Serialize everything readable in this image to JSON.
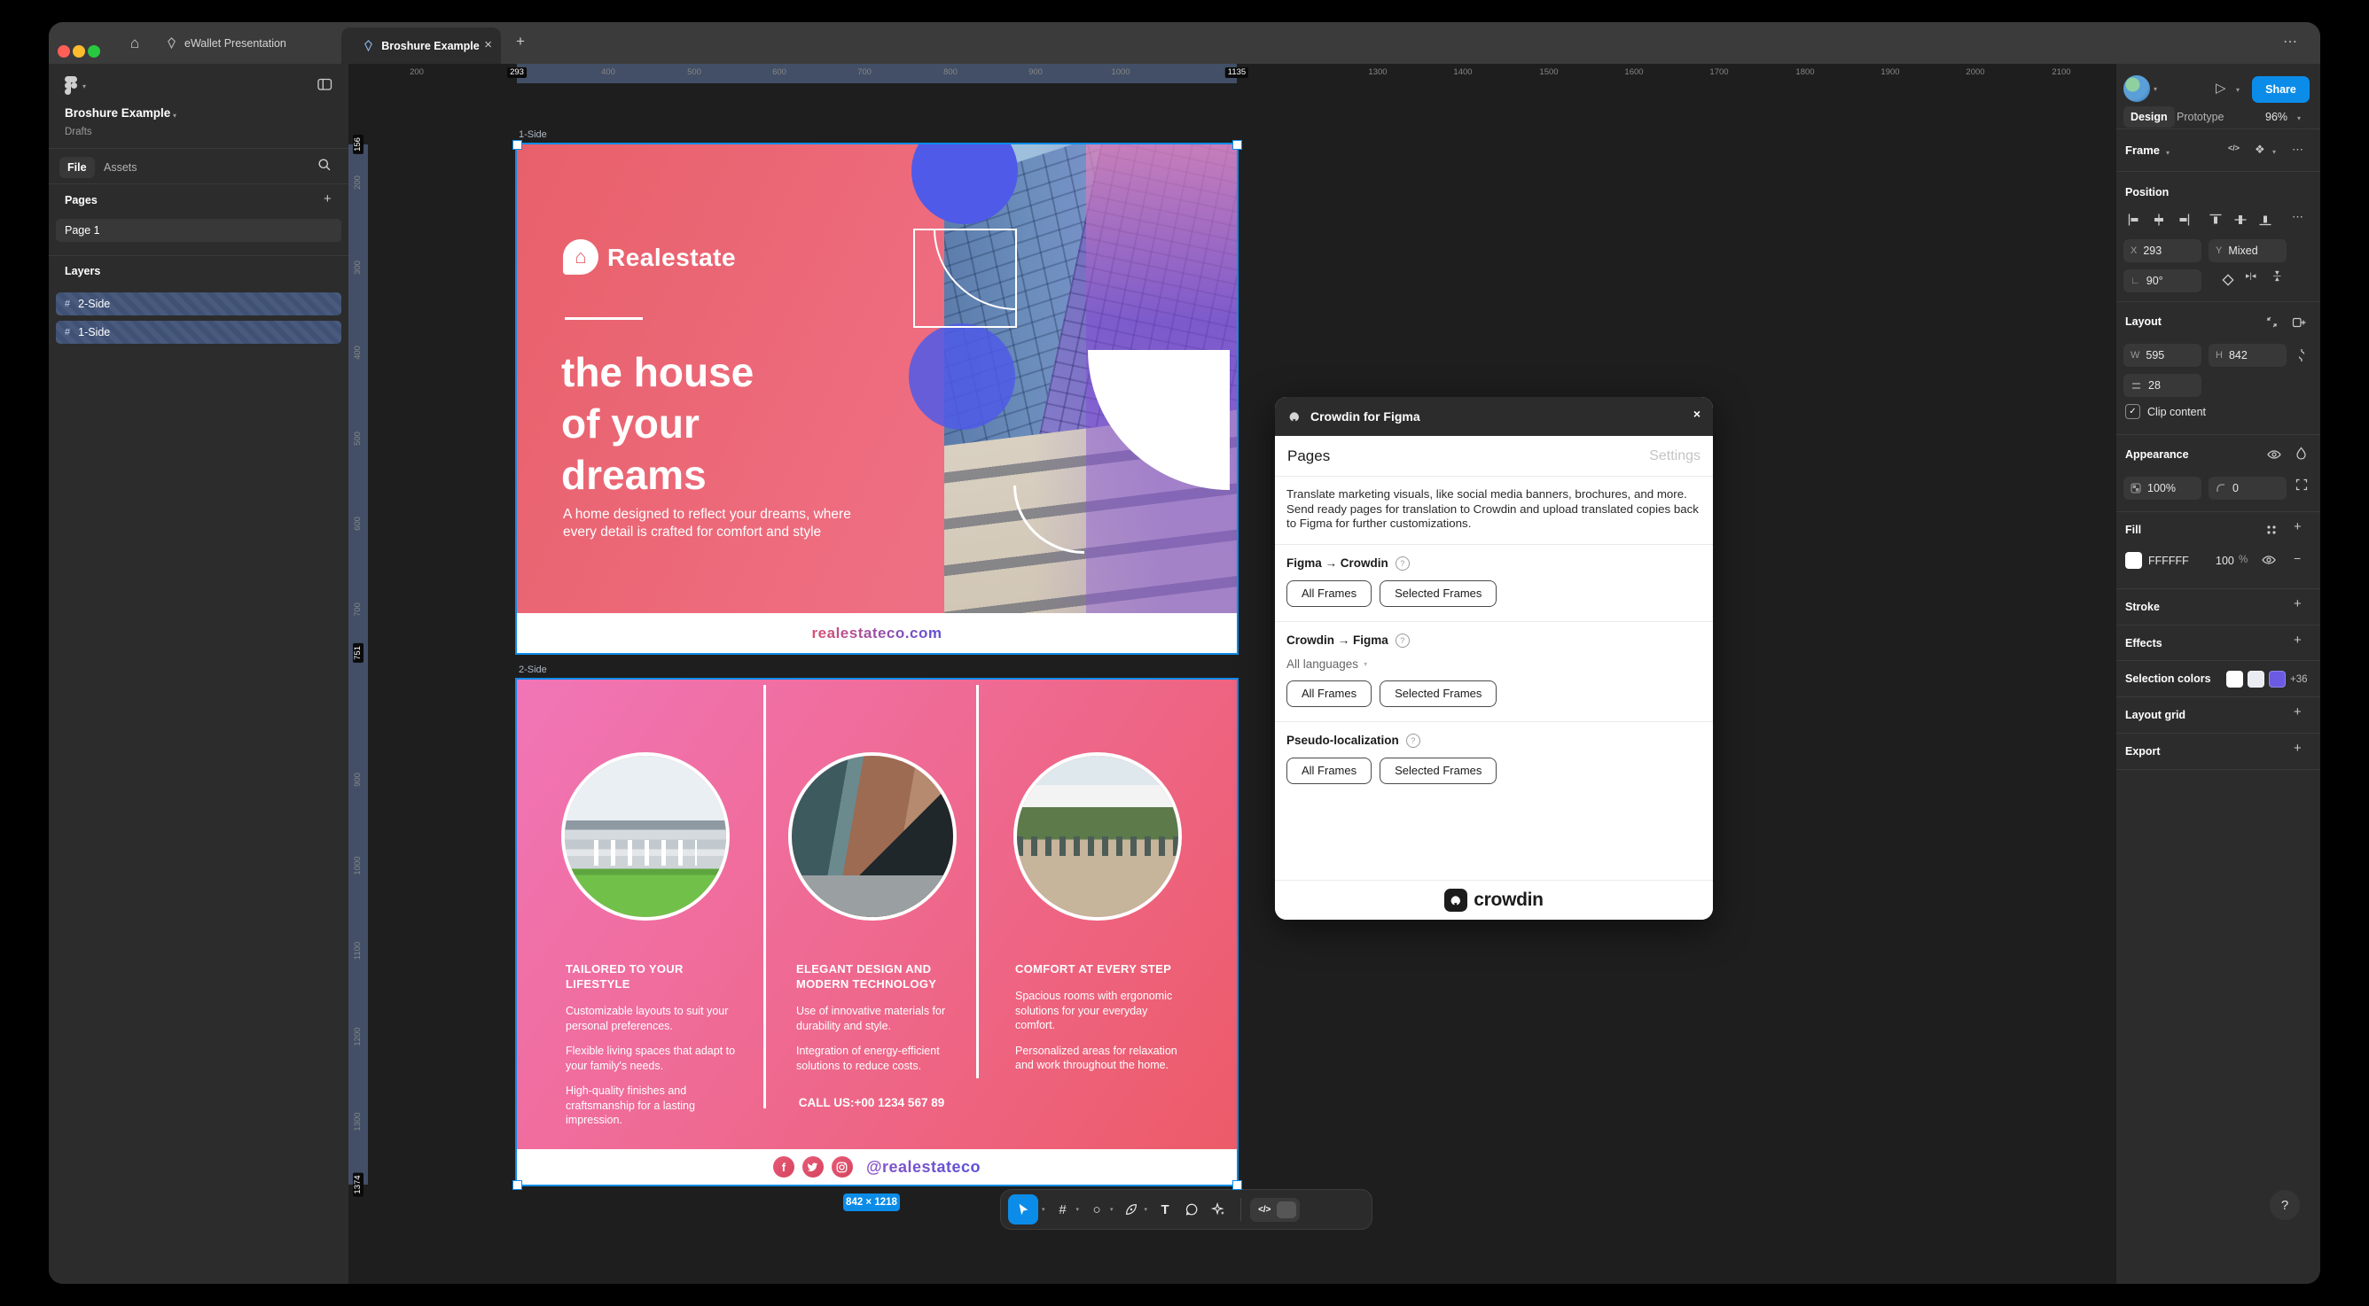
{
  "icons": {
    "home": "⌂",
    "chevron": "▾",
    "close": "×",
    "plus": "+",
    "more": "⋯",
    "hash": "#",
    "circle_tool": "○",
    "text_tool": "T",
    "dev_code": "</>",
    "help": "?",
    "play": "▷",
    "check": "✓",
    "minus": "−",
    "component": "❖",
    "angle": "∟"
  },
  "colors": {
    "accent_blue": "#0C8CE9",
    "traffic": [
      "#FF5F57",
      "#FEBC2E",
      "#28C840"
    ],
    "selection_swatches": [
      "#FFFFFF",
      "#E9EDF2",
      "#6A5BE2"
    ],
    "brochure1_gradient": [
      "#E8606A",
      "#F0738F"
    ],
    "brochure2_gradient": [
      "#F175B7",
      "#EC5A66"
    ]
  },
  "titlebar": {
    "tabs": [
      {
        "label": "eWallet Presentation"
      },
      {
        "label": "Broshure Example"
      }
    ]
  },
  "sidebar": {
    "file_name": "Broshure Example",
    "location": "Drafts",
    "file_tab": "File",
    "assets_tab": "Assets",
    "pages_label": "Pages",
    "page1": "Page 1",
    "layers_label": "Layers",
    "layers": [
      {
        "name": "2-Side"
      },
      {
        "name": "1-Side"
      }
    ]
  },
  "canvas": {
    "frame1_label": "1-Side",
    "frame2_label": "2-Side",
    "size_badge": "842 × 1218",
    "h_band": [
      190,
      1002
    ],
    "v_band": [
      91,
      1265
    ],
    "h_ticks": [
      {
        "t": "200",
        "p": 77
      },
      {
        "t": "293",
        "p": 190,
        "hl": true
      },
      {
        "t": "400",
        "p": 293
      },
      {
        "t": "500",
        "p": 390
      },
      {
        "t": "600",
        "p": 486
      },
      {
        "t": "700",
        "p": 582
      },
      {
        "t": "800",
        "p": 679
      },
      {
        "t": "900",
        "p": 775
      },
      {
        "t": "1000",
        "p": 871
      },
      {
        "t": "1135",
        "p": 1002,
        "hl": true
      },
      {
        "t": "1300",
        "p": 1161
      },
      {
        "t": "1400",
        "p": 1257
      },
      {
        "t": "1500",
        "p": 1354
      },
      {
        "t": "1600",
        "p": 1450
      },
      {
        "t": "1700",
        "p": 1546
      },
      {
        "t": "1800",
        "p": 1643
      },
      {
        "t": "1900",
        "p": 1739
      },
      {
        "t": "2000",
        "p": 1835
      },
      {
        "t": "2100",
        "p": 1932
      }
    ],
    "v_ticks": [
      {
        "t": "156",
        "p": 91,
        "hl": true
      },
      {
        "t": "200",
        "p": 134
      },
      {
        "t": "300",
        "p": 230
      },
      {
        "t": "400",
        "p": 326
      },
      {
        "t": "500",
        "p": 423
      },
      {
        "t": "600",
        "p": 519
      },
      {
        "t": "700",
        "p": 616
      },
      {
        "t": "751",
        "p": 665,
        "hl": true
      },
      {
        "t": "900",
        "p": 808
      },
      {
        "t": "1000",
        "p": 905
      },
      {
        "t": "1100",
        "p": 1001
      },
      {
        "t": "1200",
        "p": 1098
      },
      {
        "t": "1300",
        "p": 1194
      },
      {
        "t": "1374",
        "p": 1265,
        "hl": true
      }
    ]
  },
  "brochure1": {
    "brand": "Realestate",
    "heading_lines": [
      "the house",
      "of your",
      "dreams"
    ],
    "body": "A home designed to reflect your dreams, where every detail is crafted for comfort and style",
    "website": "realestateco.com"
  },
  "brochure2": {
    "columns": [
      {
        "title": "TAILORED TO YOUR LIFESTYLE",
        "paras": [
          "Customizable layouts to suit your personal preferences.",
          "Flexible living spaces that adapt to your family's needs.",
          "High-quality finishes and craftsmanship for a lasting impression."
        ]
      },
      {
        "title": "ELEGANT DESIGN AND MODERN TECHNOLOGY",
        "paras": [
          "Use of innovative materials for durability and style.",
          "Integration of energy-efficient solutions to reduce costs."
        ]
      },
      {
        "title": "COMFORT AT EVERY STEP",
        "paras": [
          "Spacious rooms with ergonomic solutions for your everyday comfort.",
          "Personalized areas for relaxation and work throughout the home."
        ]
      }
    ],
    "call": "CALL US:+00 1234 567 89",
    "social_handle": "@realestateco",
    "social_icons": [
      "facebook-icon",
      "twitter-icon",
      "instagram-icon"
    ]
  },
  "dialog": {
    "title": "Crowdin for Figma",
    "tab_pages": "Pages",
    "tab_settings": "Settings",
    "description": "Translate marketing visuals, like social media banners, brochures, and more. Send ready pages for translation to Crowdin and upload translated copies back to Figma for further customizations.",
    "sections": [
      {
        "title": "Figma → Crowdin",
        "btn_all": "All Frames",
        "btn_selected": "Selected Frames"
      },
      {
        "title": "Crowdin → Figma",
        "dropdown": "All languages",
        "btn_all": "All Frames",
        "btn_selected": "Selected Frames"
      },
      {
        "title": "Pseudo-localization",
        "btn_all": "All Frames",
        "btn_selected": "Selected Frames"
      }
    ],
    "brand": "crowdin"
  },
  "inspector": {
    "share": "Share",
    "design_tab": "Design",
    "prototype_tab": "Prototype",
    "zoom": "96%",
    "selection": "Frame",
    "position_label": "Position",
    "x_key": "X",
    "x": "293",
    "y_key": "Y",
    "y": "Mixed",
    "rotation": "90°",
    "layout_label": "Layout",
    "w_key": "W",
    "w": "595",
    "h_key": "H",
    "h": "842",
    "gap": "28",
    "clip_label": "Clip content",
    "appearance_label": "Appearance",
    "opacity": "100%",
    "radius": "0",
    "fill_label": "Fill",
    "fill_hex": "FFFFFF",
    "fill_opacity": "100",
    "percent": "%",
    "stroke_label": "Stroke",
    "effects_label": "Effects",
    "selection_colors_label": "Selection colors",
    "selection_more": "+36",
    "layout_grid_label": "Layout grid",
    "export_label": "Export"
  }
}
